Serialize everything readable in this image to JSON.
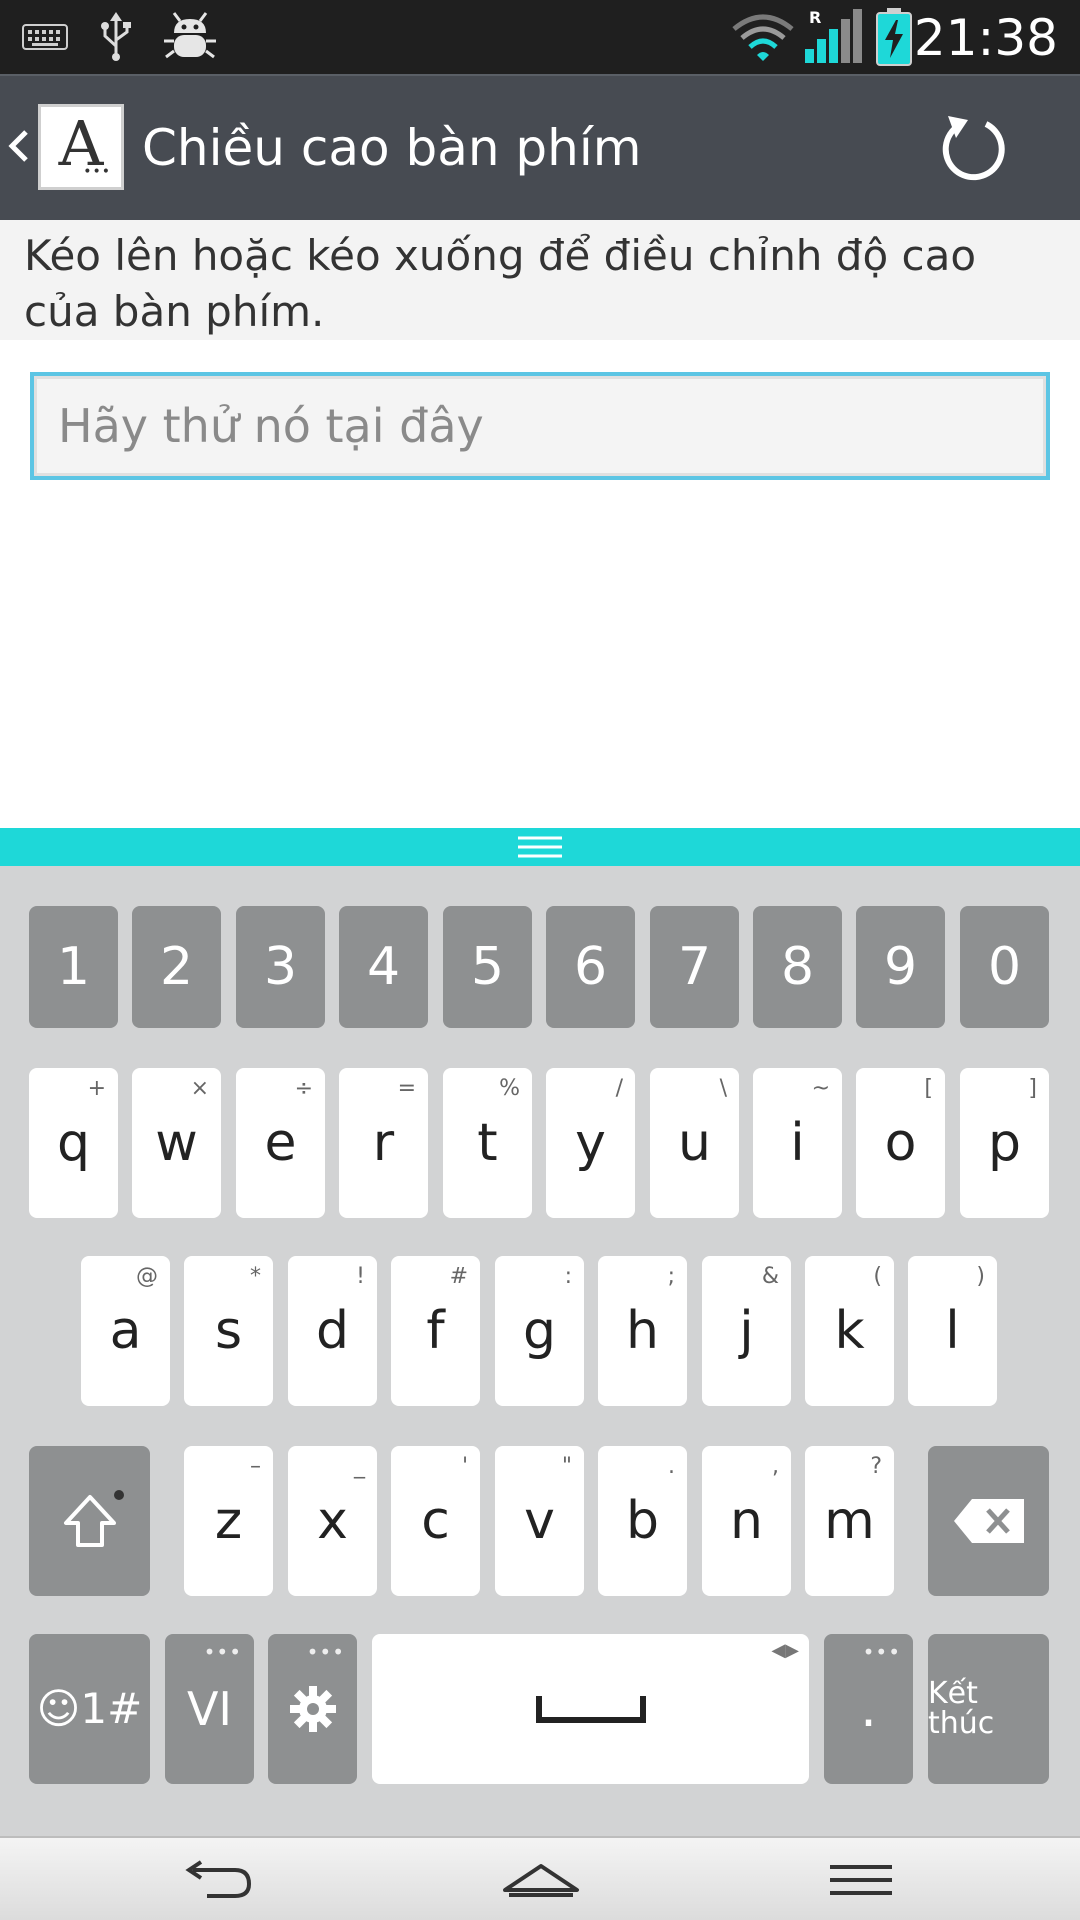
{
  "status_bar": {
    "time": "21:38",
    "icons": [
      "keyboard-icon",
      "usb-icon",
      "debug-bug-icon",
      "wifi-icon",
      "roaming-signal-icon",
      "battery-charging-icon"
    ],
    "roaming_label": "R"
  },
  "action_bar": {
    "title": "Chiều cao bàn phím",
    "app_icon_letter": "A",
    "colors": {
      "background": "#474b52"
    }
  },
  "description": "Kéo lên hoặc kéo xuống để điều chỉnh độ cao của bàn phím.",
  "input": {
    "placeholder": "Hãy thử nó tại đây",
    "value": ""
  },
  "keyboard": {
    "accent": "#1ed8d8",
    "number_row": [
      "1",
      "2",
      "3",
      "4",
      "5",
      "6",
      "7",
      "8",
      "9",
      "0"
    ],
    "row1": [
      {
        "main": "q",
        "sub": "+"
      },
      {
        "main": "w",
        "sub": "×"
      },
      {
        "main": "e",
        "sub": "÷"
      },
      {
        "main": "r",
        "sub": "="
      },
      {
        "main": "t",
        "sub": "%"
      },
      {
        "main": "y",
        "sub": "/"
      },
      {
        "main": "u",
        "sub": "\\"
      },
      {
        "main": "i",
        "sub": "~"
      },
      {
        "main": "o",
        "sub": "["
      },
      {
        "main": "p",
        "sub": "]"
      }
    ],
    "row2": [
      {
        "main": "a",
        "sub": "@"
      },
      {
        "main": "s",
        "sub": "*"
      },
      {
        "main": "d",
        "sub": "!"
      },
      {
        "main": "f",
        "sub": "#"
      },
      {
        "main": "g",
        "sub": ":"
      },
      {
        "main": "h",
        "sub": ";"
      },
      {
        "main": "j",
        "sub": "&"
      },
      {
        "main": "k",
        "sub": "("
      },
      {
        "main": "l",
        "sub": ")"
      }
    ],
    "row3": [
      {
        "main": "z",
        "sub": "–"
      },
      {
        "main": "x",
        "sub": "_"
      },
      {
        "main": "c",
        "sub": "'"
      },
      {
        "main": "v",
        "sub": "\""
      },
      {
        "main": "b",
        "sub": "."
      },
      {
        "main": "n",
        "sub": ","
      },
      {
        "main": "m",
        "sub": "?"
      }
    ],
    "bottom": {
      "symbols_label": "☺1#",
      "language_label": "VI",
      "period_label": ".",
      "done_label": "Kết thúc"
    }
  }
}
